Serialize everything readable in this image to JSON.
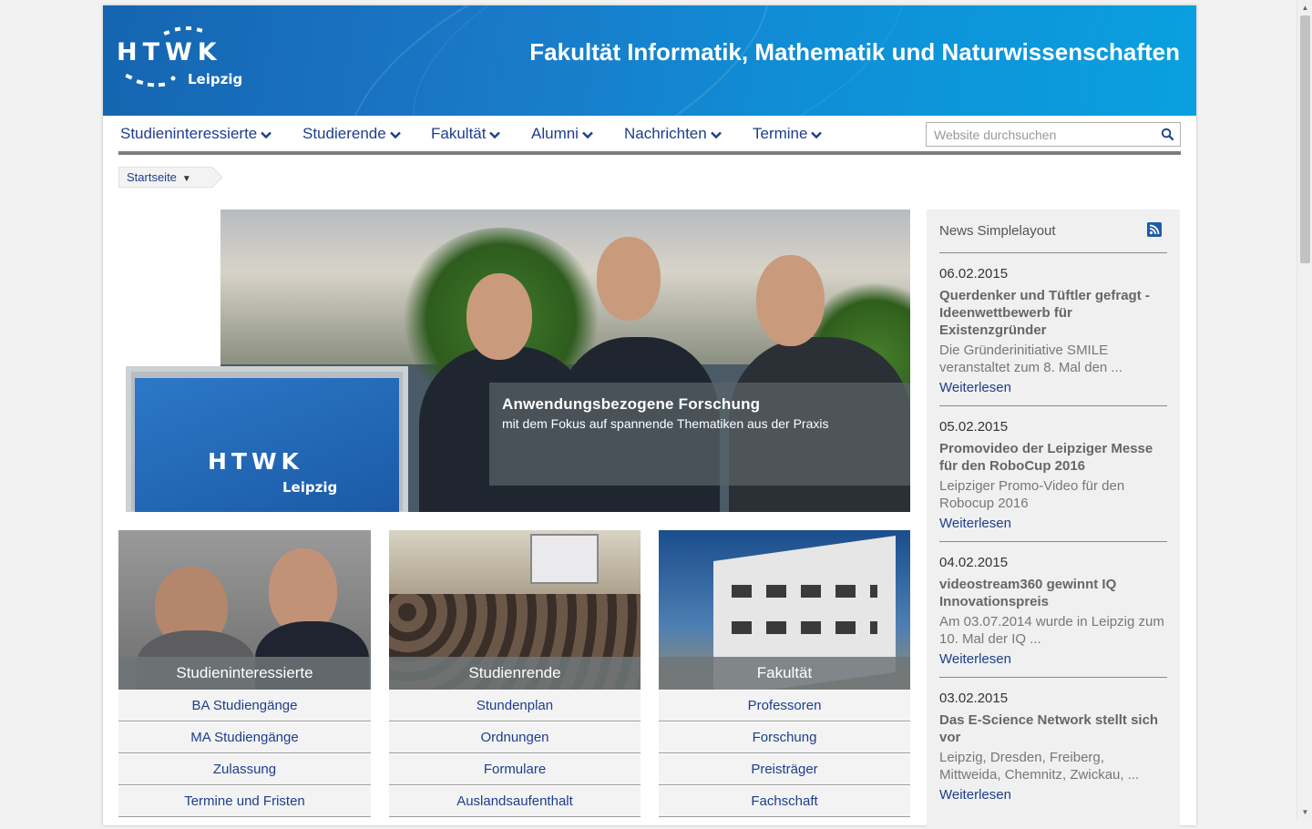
{
  "header": {
    "logo_letters": "HTWK",
    "logo_city": "Leipzig",
    "faculty_title": "Fakultät Informatik, Mathematik und Naturwissenschaften"
  },
  "nav": {
    "items": [
      {
        "label": "Studieninteressierte"
      },
      {
        "label": "Studierende"
      },
      {
        "label": "Fakultät"
      },
      {
        "label": "Alumni"
      },
      {
        "label": "Nachrichten"
      },
      {
        "label": "Termine"
      }
    ],
    "search_placeholder": "Website durchsuchen"
  },
  "breadcrumb": {
    "label": "Startseite"
  },
  "hero": {
    "screen_logo_letters": "HTWK",
    "screen_logo_city": "Leipzig",
    "title": "Anwendungsbezogene Forschung",
    "subtitle": "mit dem Fokus auf spannende Thematiken aus der Praxis"
  },
  "cards": [
    {
      "label": "Studieninteressierte",
      "links": [
        "BA Studiengänge",
        "MA Studiengänge",
        "Zulassung",
        "Termine und Fristen"
      ]
    },
    {
      "label": "Studienrende",
      "links": [
        "Stundenplan",
        "Ordnungen",
        "Formulare",
        "Auslandsaufenthalt"
      ]
    },
    {
      "label": "Fakultät",
      "links": [
        "Professoren",
        "Forschung",
        "Preisträger",
        "Fachschaft"
      ]
    }
  ],
  "sidebar": {
    "title": "News Simplelayout",
    "rss_icon": "rss-icon",
    "news": [
      {
        "date": "06.02.2015",
        "headline": "Querdenker und Tüftler gefragt - Ideenwettbewerb für Existenzgründer",
        "teaser": "Die Gründerinitiative SMILE veranstaltet zum 8. Mal den ...",
        "more": "Weiterlesen"
      },
      {
        "date": "05.02.2015",
        "headline": "Promovideo der Leipziger Messe für den RoboCup 2016",
        "teaser": "Leipziger Promo-Video für den Robocup 2016",
        "more": "Weiterlesen"
      },
      {
        "date": "04.02.2015",
        "headline": "videostream360 gewinnt IQ Innovationspreis",
        "teaser": "Am 03.07.2014 wurde in Leipzig zum 10. Mal der IQ ...",
        "more": "Weiterlesen"
      },
      {
        "date": "03.02.2015",
        "headline": "Das E-Science Network stellt sich vor",
        "teaser": "Leipzig, Dresden, Freiberg, Mittweida, Chemnitz, Zwickau, ...",
        "more": "Weiterlesen"
      }
    ]
  },
  "colors": {
    "header_blue": "#1a78c8",
    "link_blue": "#1d3e8c"
  }
}
